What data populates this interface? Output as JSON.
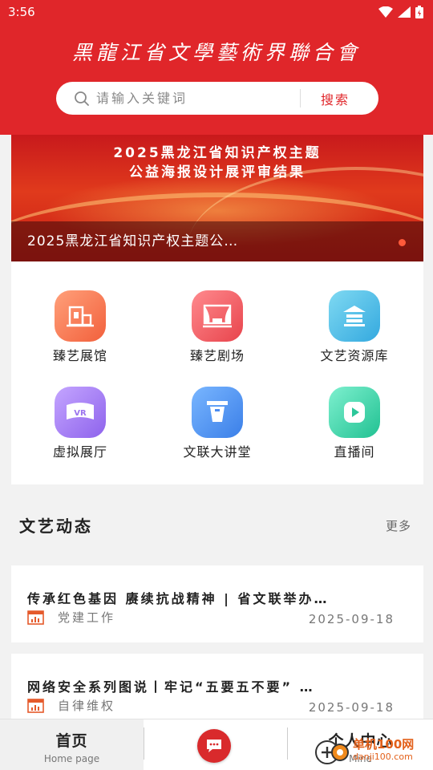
{
  "status": {
    "time": "3:56"
  },
  "header": {
    "brand": "黑龍江省文學藝術界聯合會",
    "search_placeholder": "请输入关键词",
    "search_button": "搜索"
  },
  "banner": {
    "headline_1": "2025黑龙江省知识产权主题",
    "headline_2": "公益海报设计展评审结果",
    "caption": "2025黑龙江省知识产权主题公…"
  },
  "quick": [
    {
      "label": "臻艺展馆",
      "icon": "museum-icon",
      "color_from": "#ffa07a",
      "color_to": "#f2603c"
    },
    {
      "label": "臻艺剧场",
      "icon": "theater-icon",
      "color_from": "#ff8a8e",
      "color_to": "#e8444c"
    },
    {
      "label": "文艺资源库",
      "icon": "library-icon",
      "color_from": "#7fd9f2",
      "color_to": "#34a9df"
    },
    {
      "label": "虚拟展厅",
      "icon": "vr-icon",
      "color_from": "#c4a5ff",
      "color_to": "#8e63ec"
    },
    {
      "label": "文联大讲堂",
      "icon": "lectern-icon",
      "color_from": "#79b6ff",
      "color_to": "#3b7fe8"
    },
    {
      "label": "直播间",
      "icon": "live-icon",
      "color_from": "#7ef0cf",
      "color_to": "#21c192"
    }
  ],
  "section": {
    "title": "文艺动态",
    "more": "更多"
  },
  "news": [
    {
      "title": "传承红色基因 赓续抗战精神 | 省文联举办…",
      "category": "党建工作",
      "date": "2025-09-18"
    },
    {
      "title": "网络安全系列图说丨牢记“五要五不要” …",
      "category": "自律维权",
      "date": "2025-09-18"
    }
  ],
  "nav": {
    "home": "首页",
    "home_sub": "Home page",
    "me": "个人中心",
    "me_sub": "Mine"
  },
  "watermark": {
    "line1": "单机100网",
    "line2": "danji100.com"
  },
  "colors": {
    "brand_red": "#e0262a",
    "page_bg": "#f2f2f2"
  }
}
